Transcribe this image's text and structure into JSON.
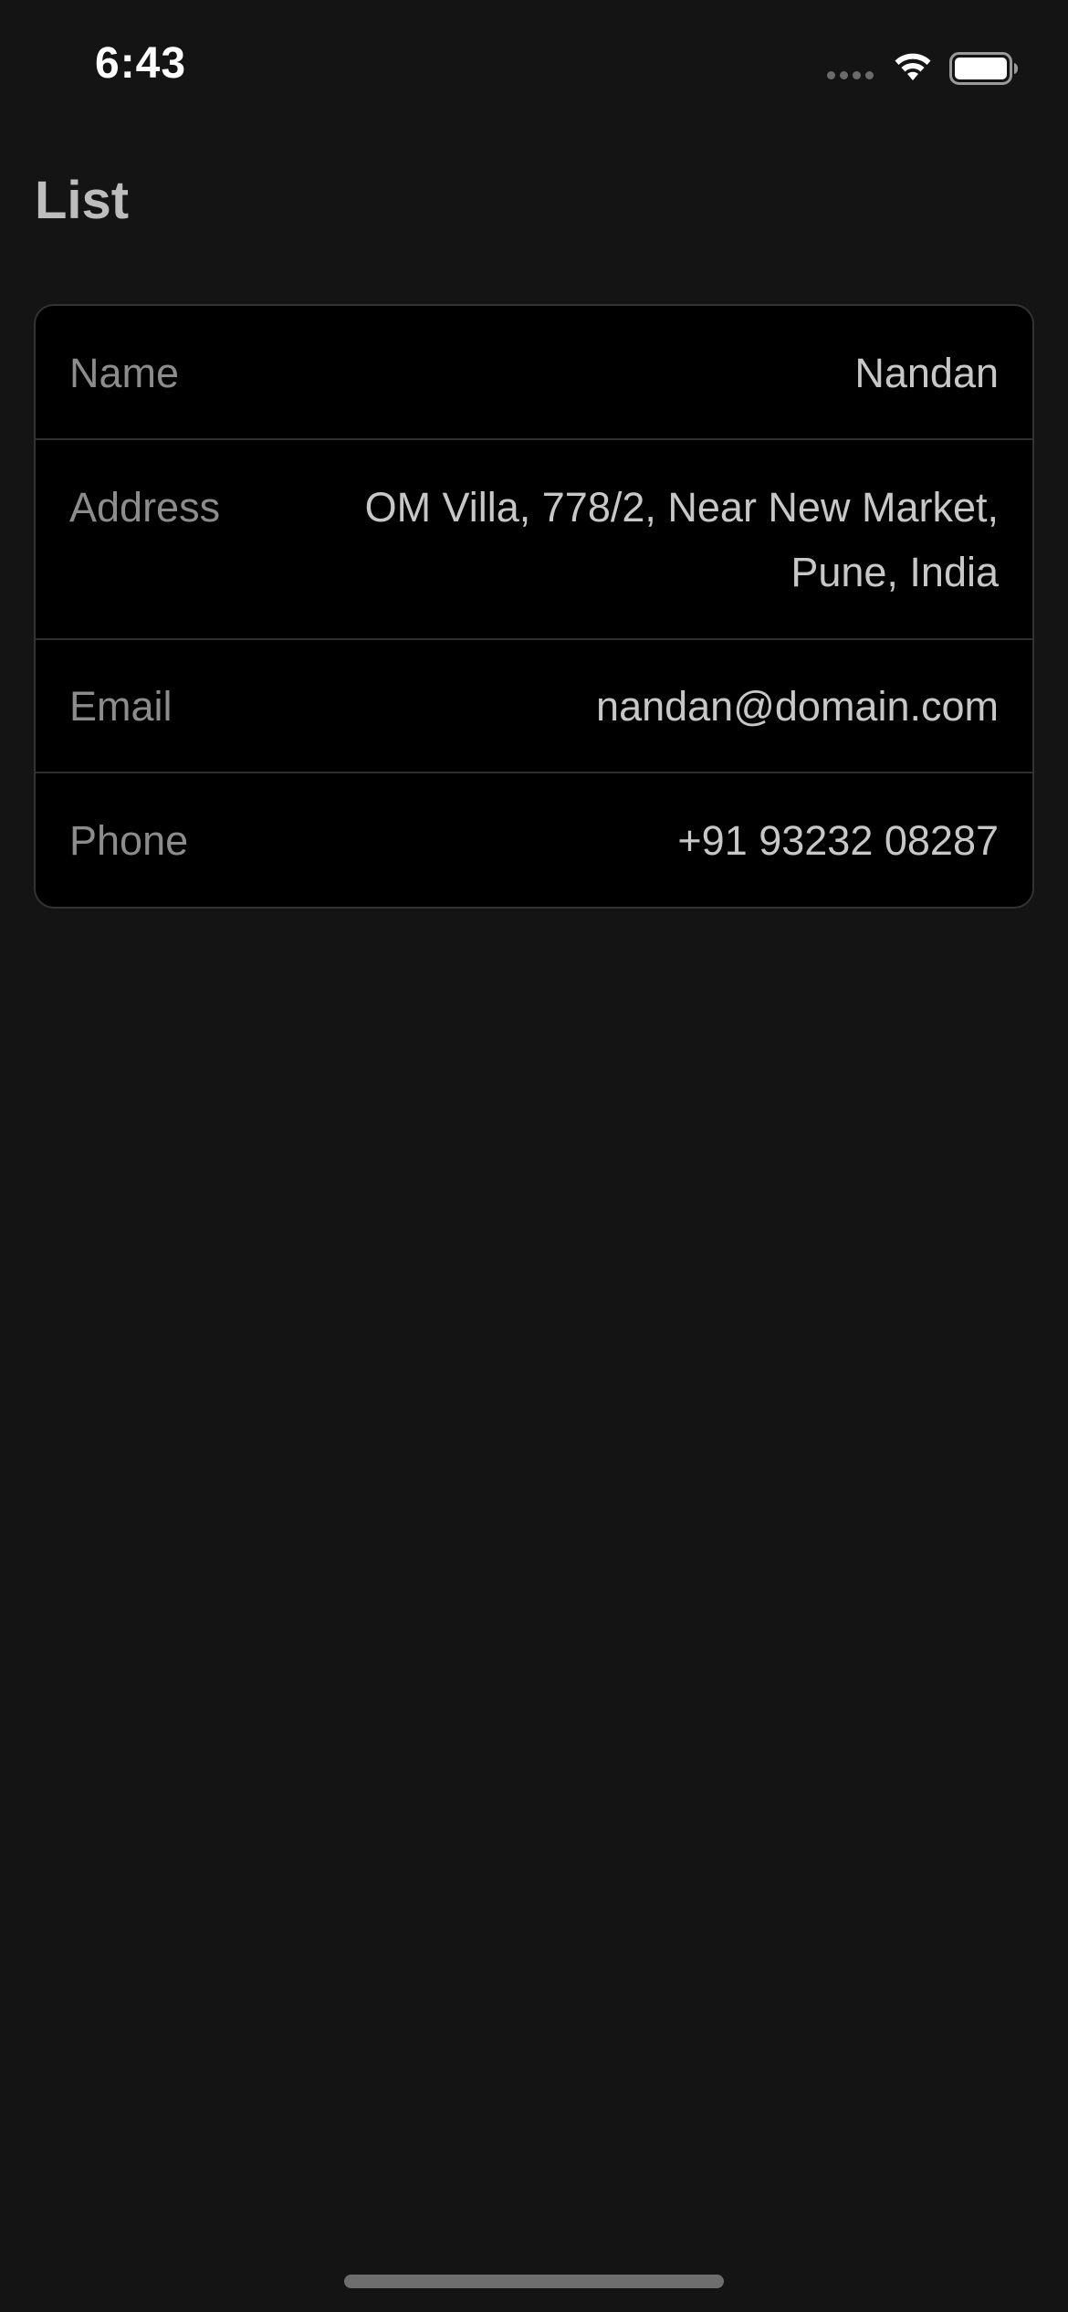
{
  "status_bar": {
    "time": "6:43",
    "icons": [
      "signal-icon",
      "wifi-icon",
      "battery-icon"
    ]
  },
  "page": {
    "title": "List"
  },
  "details": {
    "rows": [
      {
        "label": "Name",
        "value": "Nandan"
      },
      {
        "label": "Address",
        "value_line1": "OM Villa, 778/2, Near New Market,",
        "value_line2": "Pune, India"
      },
      {
        "label": "Email",
        "value": "nandan@domain.com"
      },
      {
        "label": "Phone",
        "value": "+91 93232 08287"
      }
    ]
  },
  "colors": {
    "background": "#141414",
    "card": "#000000",
    "label": "#8c8c8c",
    "value": "#c7c7c7",
    "title": "#bdbdbd"
  }
}
